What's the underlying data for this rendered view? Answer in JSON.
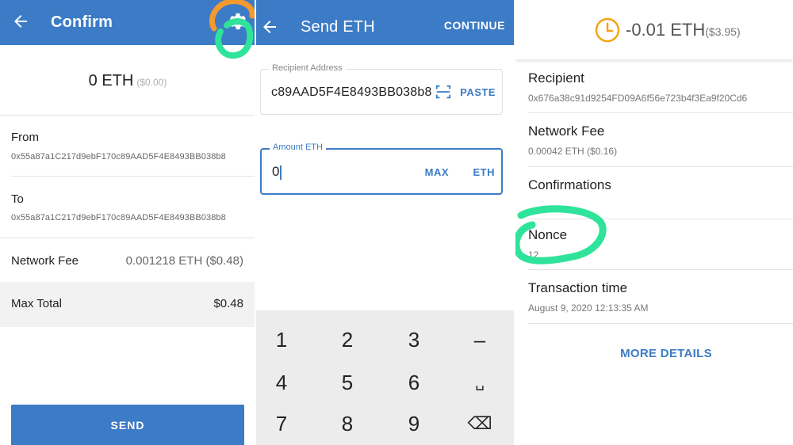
{
  "confirm": {
    "title": "Confirm",
    "amount": "0 ETH",
    "amount_fiat": "($0.00)",
    "from_label": "From",
    "from_address": "0x55a87a1C217d9ebF170c89AAD5F4E8493BB038b8",
    "to_label": "To",
    "to_address": "0x55a87a1C217d9ebF170c89AAD5F4E8493BB038b8",
    "network_fee_label": "Network Fee",
    "network_fee_value": "0.001218 ETH ($0.48)",
    "max_total_label": "Max Total",
    "max_total_value": "$0.48",
    "send_label": "SEND"
  },
  "send_eth": {
    "title": "Send ETH",
    "continue_label": "CONTINUE",
    "recipient_legend": "Recipient Address",
    "recipient_value": "c89AAD5F4E8493BB038b8",
    "paste_label": "PASTE",
    "amount_legend": "Amount ETH",
    "amount_value": "0",
    "max_label": "MAX",
    "unit_label": "ETH",
    "keys": [
      "1",
      "2",
      "3",
      "–",
      "4",
      "5",
      "6",
      "␣",
      "7",
      "8",
      "9",
      "⌫"
    ]
  },
  "details": {
    "amount": "-0.01 ETH",
    "amount_fiat": "($3.95)",
    "recipient_label": "Recipient",
    "recipient_value": "0x676a38c91d9254FD09A6f56e723b4f3Ea9f20Cd6",
    "network_fee_label": "Network Fee",
    "network_fee_value": "0.00042 ETH ($0.16)",
    "confirmations_label": "Confirmations",
    "nonce_label": "Nonce",
    "nonce_value": "12",
    "tx_time_label": "Transaction time",
    "tx_time_value": "August 9, 2020 12:13:35 AM",
    "more_details_label": "MORE DETAILS"
  },
  "colors": {
    "accent": "#3c7bc6",
    "highlight_orange": "#f39a2e",
    "highlight_green": "#2fe39a"
  }
}
